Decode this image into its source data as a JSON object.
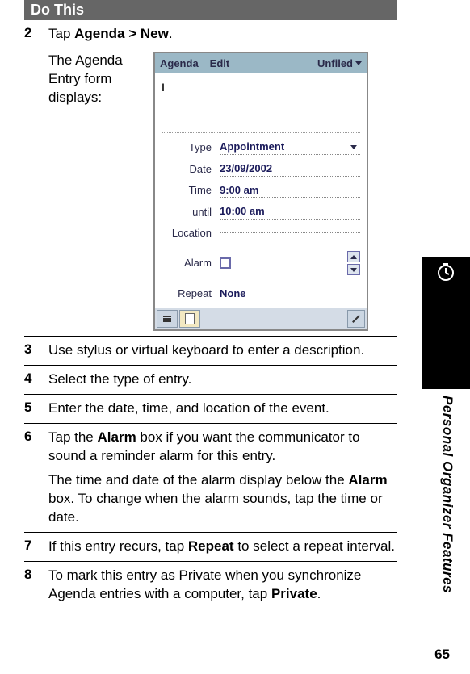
{
  "header": "Do This",
  "sidebar_label": "Personal Organizer Features",
  "page_number": "65",
  "steps": {
    "s2": {
      "num": "2",
      "prefix": "Tap ",
      "bold": "Agenda > New",
      "suffix": ".",
      "para": "The Agenda Entry form displays:"
    },
    "s3": {
      "num": "3",
      "text": "Use stylus or virtual keyboard to enter a description."
    },
    "s4": {
      "num": "4",
      "text": "Select the type of entry."
    },
    "s5": {
      "num": "5",
      "text": "Enter the date, time, and location of the event."
    },
    "s6": {
      "num": "6",
      "p1_pre": "Tap the ",
      "p1_b1": "Alarm",
      "p1_post": " box if you want the communicator to sound a reminder alarm for this entry.",
      "p2_pre": "The time and date of the alarm display below the ",
      "p2_b1": "Alarm",
      "p2_post": " box. To change when the alarm sounds, tap the time or date."
    },
    "s7": {
      "num": "7",
      "pre": "If this entry recurs, tap ",
      "b": "Repeat",
      "post": " to select a repeat interval."
    },
    "s8": {
      "num": "8",
      "pre": "To mark this entry as Private when you synchronize Agenda entries with a computer, tap ",
      "b": "Private",
      "post": "."
    }
  },
  "screenshot": {
    "titlebar": {
      "agenda": "Agenda",
      "edit": "Edit",
      "unfiled": "Unfiled"
    },
    "cursor": "I",
    "fields": {
      "type_label": "Type",
      "type_val": "Appointment",
      "date_label": "Date",
      "date_val": "23/09/2002",
      "time_label": "Time",
      "time_val": "9:00 am",
      "until_label": "until",
      "until_val": "10:00 am",
      "location_label": "Location",
      "alarm_label": "Alarm",
      "repeat_label": "Repeat",
      "repeat_val": "None"
    }
  }
}
